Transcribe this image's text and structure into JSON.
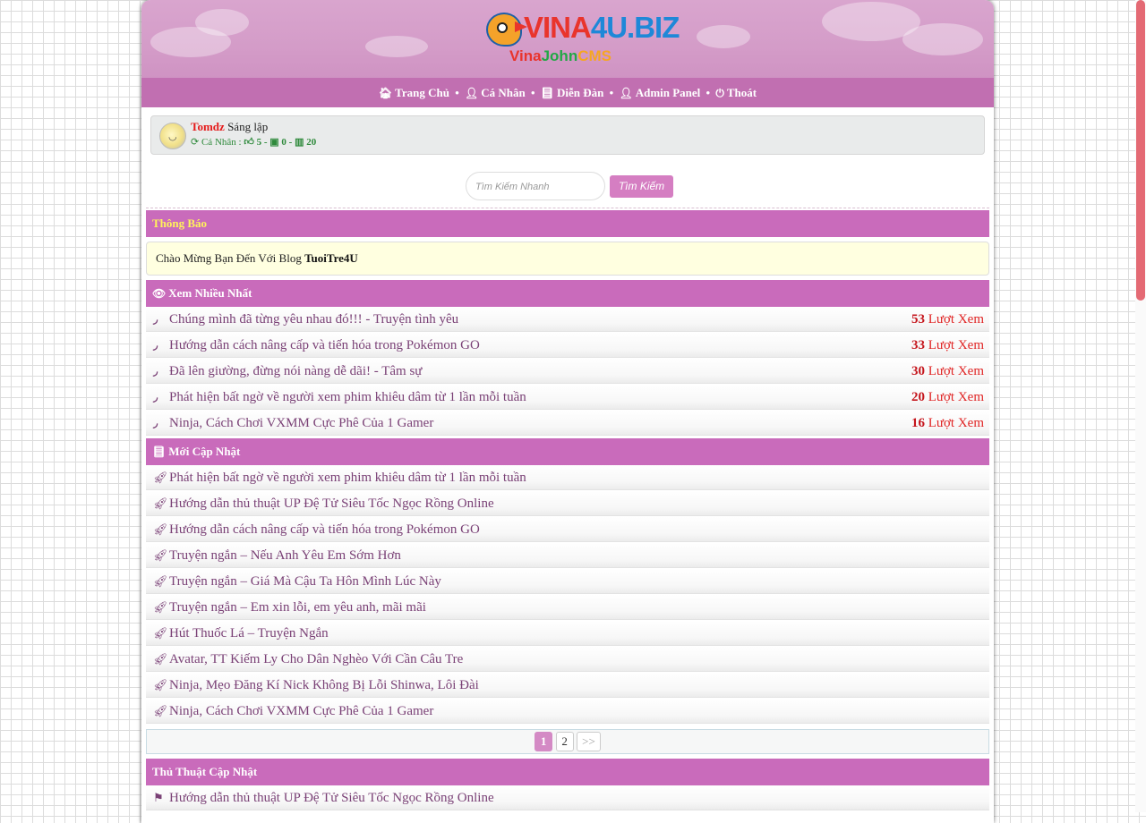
{
  "header": {
    "logo_part1": "VINA",
    "logo_part2": "4U.BIZ",
    "logo_sub1": "Vina",
    "logo_sub2": "John",
    "logo_sub3": "CMS"
  },
  "nav": {
    "items": [
      {
        "label": "Trang Chủ",
        "icon": "home-icon"
      },
      {
        "label": "Cá Nhân",
        "icon": "user-icon"
      },
      {
        "label": "Diễn Đàn",
        "icon": "book-icon"
      },
      {
        "label": "Admin Panel",
        "icon": "user-icon"
      },
      {
        "label": "Thoát",
        "icon": "power-icon"
      }
    ],
    "separator": "•"
  },
  "user": {
    "name": "Tomdz",
    "role": "Sáng lập",
    "personal_label": "Cá Nhân :",
    "likes": "5",
    "messages": "0",
    "posts": "20",
    "dash": "-"
  },
  "search": {
    "placeholder": "Tìm Kiếm Nhanh",
    "button": "Tìm Kiếm"
  },
  "notice": {
    "title": "Thông Báo",
    "text": "Chào Mừng Bạn Đến Với Blog",
    "blog_name": "TuoiTre4U"
  },
  "most_viewed": {
    "title": "Xem Nhiều Nhất",
    "views_label": "Lượt Xem",
    "items": [
      {
        "title": "Chúng mình đã từng yêu nhau đó!!! - Truyện tình yêu",
        "views": "53"
      },
      {
        "title": "Hướng dẫn cách nâng cấp và tiến hóa trong Pokémon GO",
        "views": "33"
      },
      {
        "title": "Đã lên giường, đừng nói nàng dễ dãi! - Tâm sự",
        "views": "30"
      },
      {
        "title": "Phát hiện bất ngờ về người xem phim khiêu dâm từ 1 lần mỗi tuần",
        "views": "20"
      },
      {
        "title": "Ninja, Cách Chơi VXMM Cực Phê Của 1 Gamer",
        "views": "16"
      }
    ]
  },
  "recent": {
    "title": "Mới Cập Nhật",
    "items": [
      "Phát hiện bất ngờ về người xem phim khiêu dâm từ 1 lần mỗi tuần",
      "Hướng dẫn thủ thuật UP Đệ Tử Siêu Tốc Ngọc Rồng Online",
      "Hướng dẫn cách nâng cấp và tiến hóa trong Pokémon GO",
      "Truyện ngắn – Nếu Anh Yêu Em Sớm Hơn",
      "Truyện ngắn – Giá Mà Cậu Ta Hôn Mình Lúc Này",
      "Truyện ngắn – Em xin lỗi, em yêu anh, mãi mãi",
      "Hút Thuốc Lá – Truyện Ngắn",
      "Avatar, TT Kiếm Ly Cho Dân Nghèo Với Cần Câu Tre",
      "Ninja, Mẹo Đăng Kí Nick Không Bị Lỗi Shinwa, Lôi Đài",
      "Ninja, Cách Chơi VXMM Cực Phê Của 1 Gamer"
    ]
  },
  "pagination": {
    "pages": [
      "1",
      "2"
    ],
    "current": "1",
    "next": ">>"
  },
  "tips": {
    "title": "Thủ Thuật Cập Nhật",
    "items": [
      "Hướng dẫn thủ thuật UP Đệ Tử Siêu Tốc Ngọc Rồng Online"
    ]
  },
  "colors": {
    "header_bar": "#c16fb1",
    "section_bar": "#c96bbb",
    "link": "#7a4176",
    "views": "#e02424",
    "notice_title": "#fff35a"
  }
}
